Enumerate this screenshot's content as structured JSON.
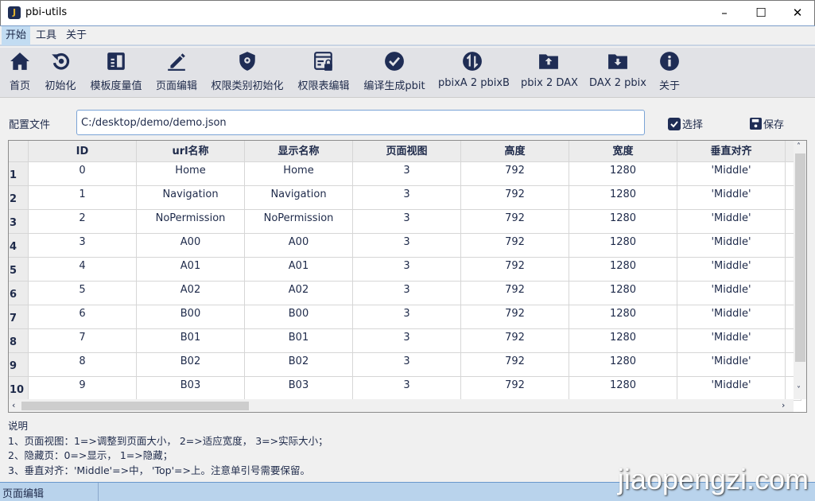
{
  "window": {
    "title": "pbi-utils",
    "icon_letter": "J",
    "minimize": "–",
    "maximize": "☐",
    "close": "✕"
  },
  "menu": [
    {
      "label": "开始",
      "active": true
    },
    {
      "label": "工具"
    },
    {
      "label": "关于"
    }
  ],
  "toolbar": [
    {
      "label": "首页",
      "icon": "home-icon"
    },
    {
      "label": "初始化",
      "icon": "reset-icon"
    },
    {
      "label": "模板度量值",
      "icon": "template-icon"
    },
    {
      "label": "页面编辑",
      "icon": "pencil-icon"
    },
    {
      "label": "权限类别初始化",
      "icon": "shield-gear-icon"
    },
    {
      "label": "权限表编辑",
      "icon": "table-lock-icon"
    },
    {
      "label": "编译生成pbit",
      "icon": "check-circle-icon"
    },
    {
      "label": "pbixA 2 pbixB",
      "icon": "swap-icon"
    },
    {
      "label": "pbix 2 DAX",
      "icon": "folder-upload-icon"
    },
    {
      "label": "DAX 2 pbix",
      "icon": "folder-download-icon"
    },
    {
      "label": "关于",
      "icon": "info-icon"
    }
  ],
  "config": {
    "label": "配置文件",
    "value": "C:/desktop/demo/demo.json",
    "select_label": "选择",
    "save_label": "保存"
  },
  "table": {
    "columns": [
      "ID",
      "url名称",
      "显示名称",
      "页面视图",
      "高度",
      "宽度",
      "垂直对齐"
    ],
    "rows": [
      [
        "0",
        "Home",
        "Home",
        "3",
        "792",
        "1280",
        "'Middle'"
      ],
      [
        "1",
        "Navigation",
        "Navigation",
        "3",
        "792",
        "1280",
        "'Middle'"
      ],
      [
        "2",
        "NoPermission",
        "NoPermission",
        "3",
        "792",
        "1280",
        "'Middle'"
      ],
      [
        "3",
        "A00",
        "A00",
        "3",
        "792",
        "1280",
        "'Middle'"
      ],
      [
        "4",
        "A01",
        "A01",
        "3",
        "792",
        "1280",
        "'Middle'"
      ],
      [
        "5",
        "A02",
        "A02",
        "3",
        "792",
        "1280",
        "'Middle'"
      ],
      [
        "6",
        "B00",
        "B00",
        "3",
        "792",
        "1280",
        "'Middle'"
      ],
      [
        "7",
        "B01",
        "B01",
        "3",
        "792",
        "1280",
        "'Middle'"
      ],
      [
        "8",
        "B02",
        "B02",
        "3",
        "792",
        "1280",
        "'Middle'"
      ],
      [
        "9",
        "B03",
        "B03",
        "3",
        "792",
        "1280",
        "'Middle'"
      ]
    ],
    "row_headers": [
      "1",
      "2",
      "3",
      "4",
      "5",
      "6",
      "7",
      "8",
      "9",
      "10"
    ]
  },
  "notes": {
    "title": "说明",
    "lines": [
      "1、页面视图：1=>调整到页面大小， 2=>适应宽度， 3=>实际大小；",
      "2、隐藏页：0=>显示， 1=>隐藏；",
      "3、垂直对齐：'Middle'=>中， 'Top'=>上。注意单引号需要保留。"
    ]
  },
  "status": {
    "text": "页面编辑"
  },
  "watermark": "jiaopengzi.com",
  "colors": {
    "icon": "#1f2d55",
    "menu_active": "#c2dcf2",
    "status_bar": "#b9d3ec"
  }
}
